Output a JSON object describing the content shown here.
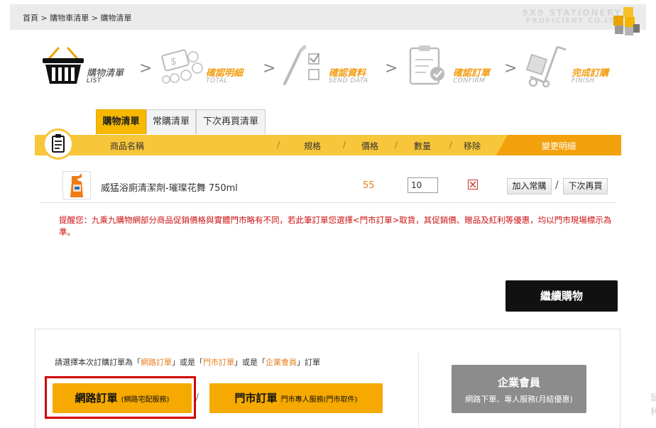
{
  "breadcrumb": {
    "items": [
      "首頁",
      "購物車清單",
      "購物清單"
    ],
    "separator": ">"
  },
  "brand": {
    "line1": "9X9 STATIONERY",
    "line2": "PROFICIENT CO.LTD"
  },
  "steps": [
    {
      "label": "購物清單",
      "sub": "LIST",
      "icon": "basket-icon",
      "state": "active"
    },
    {
      "label": "確認明細",
      "sub": "TOTAL",
      "icon": "coins-icon",
      "state": "inactive"
    },
    {
      "label": "確認資料",
      "sub": "SEND DATA",
      "icon": "checklist-pen-icon",
      "state": "inactive"
    },
    {
      "label": "確認訂單",
      "sub": "CONFIRM",
      "icon": "clipboard-check-icon",
      "state": "inactive"
    },
    {
      "label": "完成訂購",
      "sub": "FINISH",
      "icon": "hand-truck-icon",
      "state": "inactive"
    }
  ],
  "step_arrow": ">",
  "tabs": [
    {
      "label": "購物清單",
      "active": true
    },
    {
      "label": "常購清單",
      "active": false
    },
    {
      "label": "下次再買清單",
      "active": false
    }
  ],
  "table_header": {
    "name": "商品名稱",
    "spec": "規格",
    "price": "價格",
    "qty": "數量",
    "remove": "移除",
    "change": "變更明細",
    "divider": "/"
  },
  "items": [
    {
      "name": "威猛浴廁清潔劑-璀璨花舞 750ml",
      "spec": "",
      "price": "55",
      "qty": "10",
      "actions": {
        "add_regular": "加入常購",
        "buy_next": "下次再買",
        "separator": "/"
      }
    }
  ],
  "notice": "提醒您：九乘九購物網部分商品促銷價格與實體門市略有不同，若此筆訂單您選擇<門市訂單>取貨，其促銷價、贈品及紅利等優惠，均以門市現場標示為準。",
  "continue_button": "繼續購物",
  "order": {
    "prompt_parts": [
      "請選擇本次訂購訂單為",
      "「",
      "網路訂單",
      "」",
      "或是",
      "「",
      "門市訂單",
      "」",
      "或是",
      "「",
      "企業會員",
      "」",
      "訂單"
    ],
    "online": {
      "title": "網路訂單",
      "sub": "(網路宅配服務)"
    },
    "store": {
      "title": "門市訂單",
      "sub": "門市專人服務(門市取件)"
    },
    "separator": "/",
    "corporate": {
      "title": "企業會員",
      "sub": "網路下單、專人服務(月結優惠)"
    }
  },
  "edge_glyphs": [
    "鼠",
    "利"
  ],
  "colors": {
    "accent_yellow": "#f8c63a",
    "accent_orange": "#f3a10c",
    "order_button": "#f6a900",
    "highlight_red": "#d20000",
    "notice_red": "#cc1111",
    "corporate_gray": "#8c8c8c"
  }
}
